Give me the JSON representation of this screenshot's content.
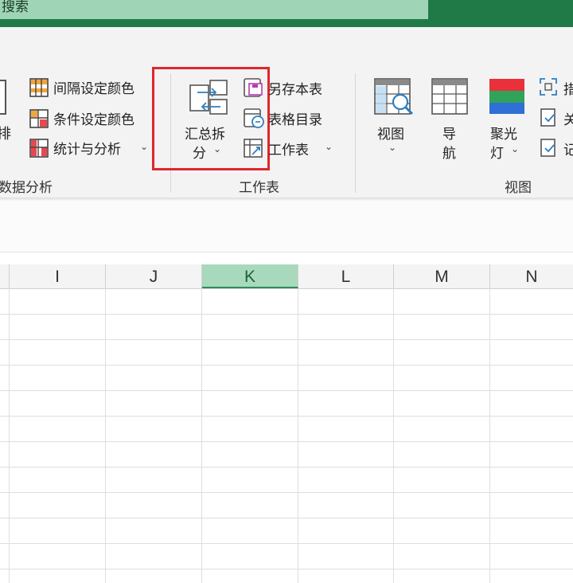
{
  "title_bar": {
    "search_label": "搜索"
  },
  "ribbon": {
    "left_partial": {
      "sort_label": "排"
    },
    "data_analysis": {
      "items": [
        {
          "label": "间隔设定颜色"
        },
        {
          "label": "条件设定颜色"
        },
        {
          "label": "统计与分析"
        }
      ],
      "group_title": "数据分析"
    },
    "worksheet": {
      "merge_split_line1": "汇总拆",
      "merge_split_line2": "分",
      "items": [
        {
          "label": "另存本表"
        },
        {
          "label": "表格目录"
        },
        {
          "label": "工作表"
        }
      ],
      "group_title": "工作表"
    },
    "view": {
      "view_label": "视图",
      "nav_line1": "导",
      "nav_line2": "航",
      "spotlight_line1": "聚光",
      "spotlight_line2": "灯",
      "right_partial": [
        {
          "label": "措"
        },
        {
          "label": "关"
        },
        {
          "label": "记"
        }
      ],
      "group_title": "视图"
    },
    "colors": {
      "spotlight_red": "#e8313a",
      "spotlight_green": "#2fa35a",
      "spotlight_blue": "#2f6fd6",
      "highlight_box": "#e0262c"
    }
  },
  "grid": {
    "columns": [
      "I",
      "J",
      "K",
      "L",
      "M",
      "N"
    ],
    "selected_column": "K",
    "accent": "#a9d9bc"
  }
}
